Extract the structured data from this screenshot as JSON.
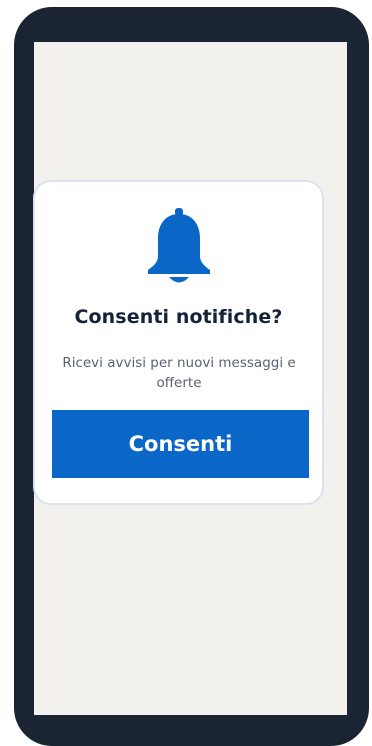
{
  "dialog": {
    "icon": "bell-icon",
    "title": "Consenti notifiche?",
    "message": "Ricevi avvisi per nuovi messaggi e offerte",
    "button_label": "Consenti"
  },
  "colors": {
    "accent": "#0a66c7",
    "frame": "#1b2433",
    "screen_background": "#f3f1ed",
    "title_text": "#14233a"
  }
}
